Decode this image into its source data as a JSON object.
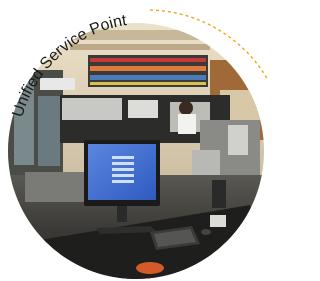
{
  "badge": {
    "curved_label": "Unified Service Point",
    "arc_color": "#f0a818",
    "text_color": "#1a1a1a"
  },
  "photo": {
    "subject": "library service desk with computer monitor, keyboard and shelves",
    "palette": {
      "wall": "#e8d8bc",
      "floor": "#30302e",
      "desk": "#1e1e1c",
      "monitor_screen": "#3f6fd0",
      "shelf": "#3c3a36"
    }
  }
}
